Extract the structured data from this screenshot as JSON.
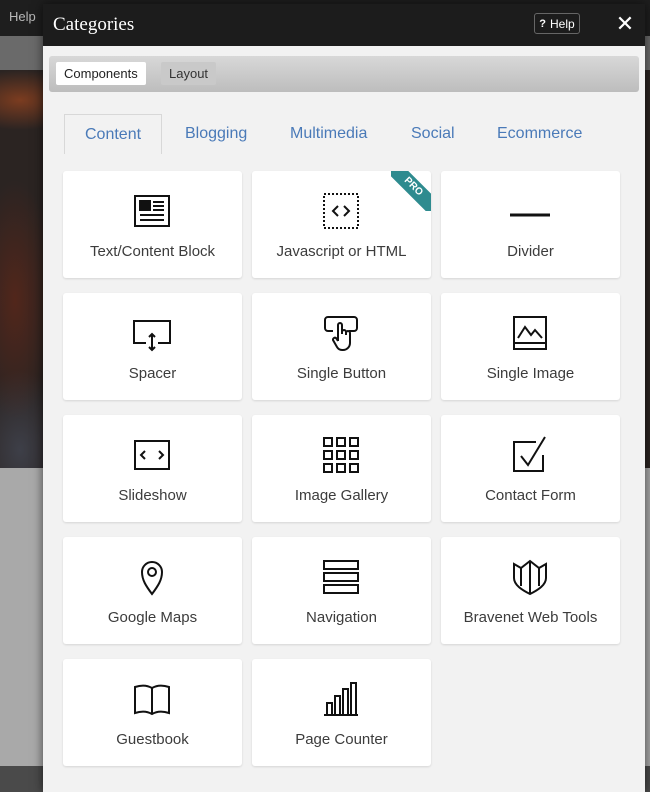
{
  "background": {
    "help_label": "Help"
  },
  "modal": {
    "title": "Categories",
    "help_label": "Help",
    "help_glyph": "?",
    "close_glyph": "✕"
  },
  "subtabs": [
    {
      "label": "Components",
      "active": true
    },
    {
      "label": "Layout",
      "active": false
    }
  ],
  "category_tabs": [
    {
      "label": "Content",
      "active": true
    },
    {
      "label": "Blogging"
    },
    {
      "label": "Multimedia"
    },
    {
      "label": "Social"
    },
    {
      "label": "Ecommerce"
    }
  ],
  "components": [
    {
      "label": "Text/Content Block",
      "icon": "text-block-icon"
    },
    {
      "label": "Javascript or HTML",
      "icon": "code-icon",
      "badge": "PRO"
    },
    {
      "label": "Divider",
      "icon": "divider-icon"
    },
    {
      "label": "Spacer",
      "icon": "spacer-icon"
    },
    {
      "label": "Single Button",
      "icon": "button-icon"
    },
    {
      "label": "Single Image",
      "icon": "image-icon"
    },
    {
      "label": "Slideshow",
      "icon": "slideshow-icon"
    },
    {
      "label": "Image Gallery",
      "icon": "gallery-icon"
    },
    {
      "label": "Contact Form",
      "icon": "contact-form-icon"
    },
    {
      "label": "Google Maps",
      "icon": "map-pin-icon"
    },
    {
      "label": "Navigation",
      "icon": "navigation-icon"
    },
    {
      "label": "Bravenet Web Tools",
      "icon": "shield-icon"
    },
    {
      "label": "Guestbook",
      "icon": "book-icon"
    },
    {
      "label": "Page Counter",
      "icon": "bar-chart-icon"
    }
  ],
  "colors": {
    "accent": "#4a7ab8",
    "pro_badge": "#2e8b8f",
    "header": "#1c1c1c"
  }
}
